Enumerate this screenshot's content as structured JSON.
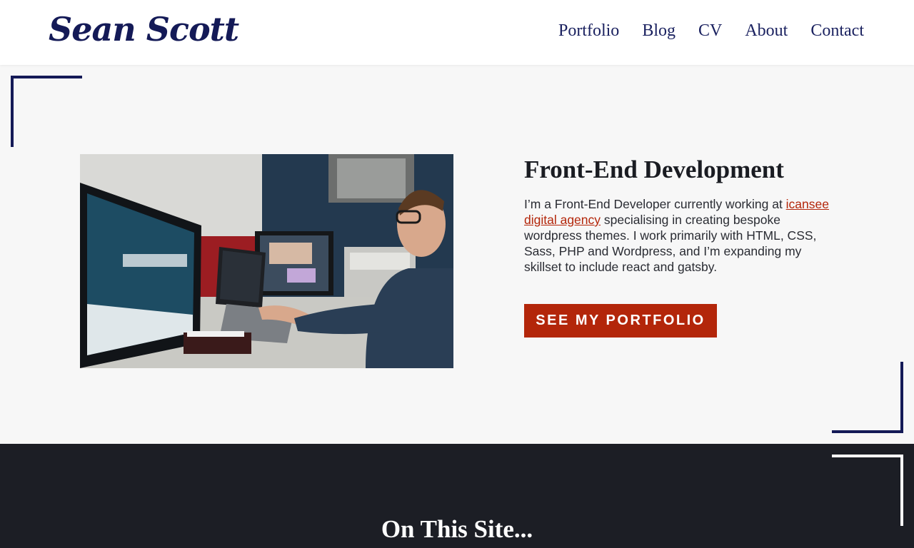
{
  "header": {
    "logo": "Sean Scott",
    "nav": [
      "Portfolio",
      "Blog",
      "CV",
      "About",
      "Contact"
    ]
  },
  "hero": {
    "image_alt": "Developer working at a desk with multiple monitors",
    "title": "Front-End Development",
    "text_before": "I’m a Front-End Developer currently working at ",
    "link": "icansee digital agency",
    "text_after": " specialising in creating bespoke wordpress themes. I work primarily with HTML, CSS, Sass, PHP and Wordpress, and I’m expanding my skillset to include react and gatsby.",
    "cta": "SEE MY PORTFOLIO"
  },
  "section": {
    "title": "On This Site..."
  },
  "colors": {
    "navy": "#141a57",
    "accent": "#b3260a",
    "dark_bg": "#1c1e25"
  }
}
